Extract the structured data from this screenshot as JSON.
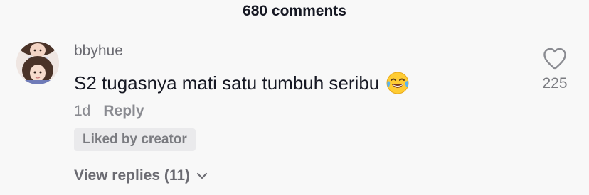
{
  "header": {
    "title": "680 comments"
  },
  "comment": {
    "username": "bbyhue",
    "text": "S2 tugasnya mati satu tumbuh seribu",
    "emoji_icon": "face-with-tears-of-joy-icon",
    "time": "1d",
    "reply_label": "Reply",
    "badge": "Liked by creator",
    "like_count": "225",
    "view_replies_label": "View replies (11)"
  },
  "colors": {
    "text_primary": "#161823",
    "text_secondary": "#8a8b91",
    "background": "#f8f8f8",
    "badge_bg": "#eaeaec"
  }
}
